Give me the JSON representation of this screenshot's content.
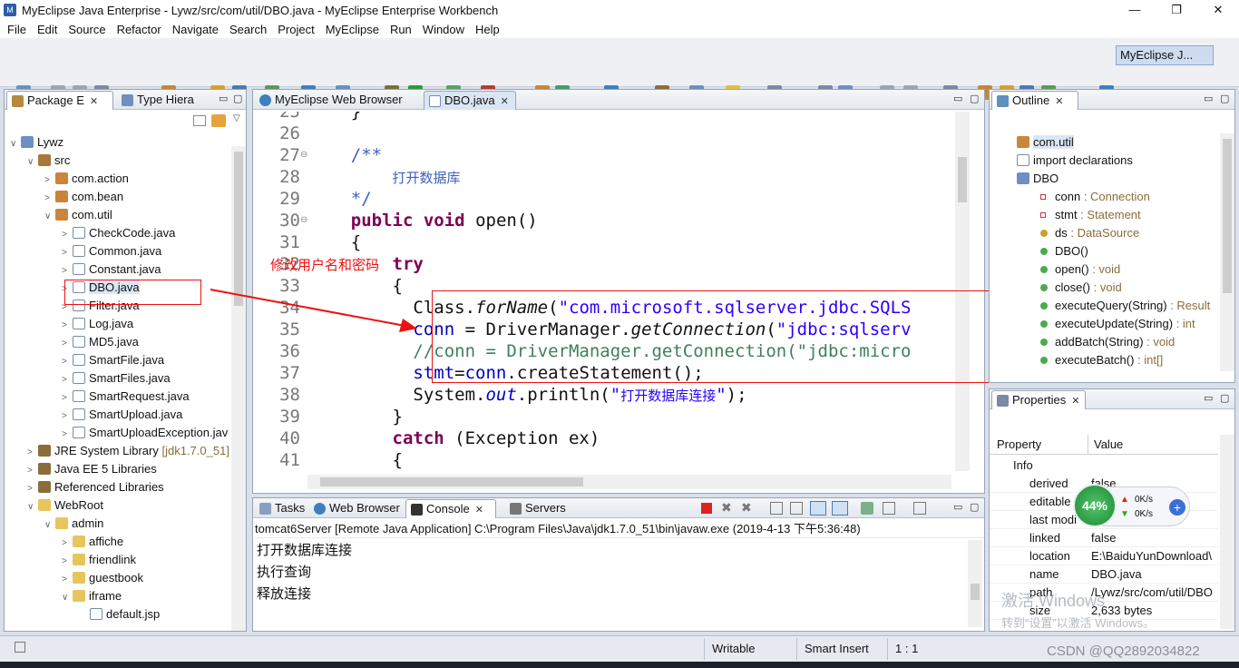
{
  "window": {
    "title": "MyEclipse Java Enterprise - Lywz/src/com/util/DBO.java - MyEclipse Enterprise Workbench",
    "minimize": "—",
    "maximize": "❐",
    "close": "✕"
  },
  "menu": [
    "File",
    "Edit",
    "Source",
    "Refactor",
    "Navigate",
    "Search",
    "Project",
    "MyEclipse",
    "Run",
    "Window",
    "Help"
  ],
  "perspective": "MyEclipse J...",
  "left_panel": {
    "tabs": [
      "Package E",
      "Type Hiera"
    ],
    "tree": [
      {
        "label": "Lywz",
        "indent": 0,
        "icon": "project-icon",
        "arrow": "∨"
      },
      {
        "label": "src",
        "indent": 1,
        "icon": "source-folder-icon",
        "arrow": "∨"
      },
      {
        "label": "com.action",
        "indent": 2,
        "icon": "package-icon",
        "arrow": ">"
      },
      {
        "label": "com.bean",
        "indent": 2,
        "icon": "package-icon",
        "arrow": ">"
      },
      {
        "label": "com.util",
        "indent": 2,
        "icon": "package-icon",
        "arrow": "∨"
      },
      {
        "label": "CheckCode.java",
        "indent": 3,
        "icon": "java-file-icon",
        "arrow": ">"
      },
      {
        "label": "Common.java",
        "indent": 3,
        "icon": "java-file-icon",
        "arrow": ">"
      },
      {
        "label": "Constant.java",
        "indent": 3,
        "icon": "java-file-icon",
        "arrow": ">"
      },
      {
        "label": "DBO.java",
        "indent": 3,
        "icon": "java-file-icon",
        "arrow": ">"
      },
      {
        "label": "Filter.java",
        "indent": 3,
        "icon": "java-file-icon",
        "arrow": ">"
      },
      {
        "label": "Log.java",
        "indent": 3,
        "icon": "java-file-icon",
        "arrow": ">"
      },
      {
        "label": "MD5.java",
        "indent": 3,
        "icon": "java-file-icon",
        "arrow": ">"
      },
      {
        "label": "SmartFile.java",
        "indent": 3,
        "icon": "java-file-icon",
        "arrow": ">"
      },
      {
        "label": "SmartFiles.java",
        "indent": 3,
        "icon": "java-file-icon",
        "arrow": ">"
      },
      {
        "label": "SmartRequest.java",
        "indent": 3,
        "icon": "java-file-icon",
        "arrow": ">"
      },
      {
        "label": "SmartUpload.java",
        "indent": 3,
        "icon": "java-file-icon",
        "arrow": ">"
      },
      {
        "label": "SmartUploadException.jav",
        "indent": 3,
        "icon": "java-file-icon",
        "arrow": ">"
      },
      {
        "label": "JRE System Library",
        "suffix": "[jdk1.7.0_51]",
        "indent": 1,
        "icon": "library-icon",
        "arrow": ">"
      },
      {
        "label": "Java EE 5 Libraries",
        "indent": 1,
        "icon": "library-icon",
        "arrow": ">"
      },
      {
        "label": "Referenced Libraries",
        "indent": 1,
        "icon": "library-icon",
        "arrow": ">"
      },
      {
        "label": "WebRoot",
        "indent": 1,
        "icon": "folder-icon",
        "arrow": "∨"
      },
      {
        "label": "admin",
        "indent": 2,
        "icon": "folder-icon",
        "arrow": "∨"
      },
      {
        "label": "affiche",
        "indent": 3,
        "icon": "folder-icon",
        "arrow": ">"
      },
      {
        "label": "friendlink",
        "indent": 3,
        "icon": "folder-icon",
        "arrow": ">"
      },
      {
        "label": "guestbook",
        "indent": 3,
        "icon": "folder-icon",
        "arrow": ">"
      },
      {
        "label": "iframe",
        "indent": 3,
        "icon": "folder-icon",
        "arrow": "∨"
      },
      {
        "label": "default.jsp",
        "indent": 4,
        "icon": "jsp-file-icon",
        "arrow": ""
      }
    ]
  },
  "editor": {
    "tabs": [
      "MyEclipse Web Browser",
      "DBO.java"
    ],
    "lines": [
      {
        "n": "25",
        "html": "    }"
      },
      {
        "n": "26",
        "html": ""
      },
      {
        "n": "27",
        "fold": "⊖",
        "html": "    <span class=\"cm\">/**</span>"
      },
      {
        "n": "28",
        "html": "        <span class=\"cm\" style=\"font-family:'DejaVu Sans',sans-serif;font-size:15px\">打开数据库</span>"
      },
      {
        "n": "29",
        "html": "    <span class=\"cm\">*/</span>"
      },
      {
        "n": "30",
        "fold": "⊖",
        "html": "    <span class=\"kw\">public</span> <span class=\"kw\">void</span> open()"
      },
      {
        "n": "31",
        "html": "    {"
      },
      {
        "n": "32",
        "html": "        <span class=\"kw\">try</span>"
      },
      {
        "n": "33",
        "html": "        {"
      },
      {
        "n": "34",
        "html": "          Class.<span class=\"it\">forName</span>(<span class=\"st\">\"com.microsoft.sqlserver.jdbc.SQLS</span>"
      },
      {
        "n": "35",
        "html": "          <span style=\"color:#0000c0\">conn</span> = DriverManager.<span class=\"it\">getConnection</span>(<span class=\"st\">\"jdbc:sqlserv</span>"
      },
      {
        "n": "36",
        "html": "          <span class=\"cgreen\">//conn = DriverManager.getConnection(\"jdbc:micro</span>"
      },
      {
        "n": "37",
        "html": "          <span style=\"color:#0000c0\">stmt</span>=<span style=\"color:#0000c0\">conn</span>.createStatement();"
      },
      {
        "n": "38",
        "html": "          System.<span class=\"it\" style=\"color:#0000c0\">out</span>.println(<span class=\"st\">\"<span style=\"font-family:'DejaVu Sans',sans-serif;font-size:15px\">打开数据库连接</span>\"</span>);"
      },
      {
        "n": "39",
        "html": "        }"
      },
      {
        "n": "40",
        "html": "        <span class=\"kw\">catch</span> (Exception ex)"
      },
      {
        "n": "41",
        "html": "        {"
      }
    ]
  },
  "annotation": {
    "text": "修改用户名和密码"
  },
  "outline": {
    "title": "Outline",
    "items": [
      {
        "label": "com.util",
        "type": "",
        "icon": "package-icon",
        "indent": 0
      },
      {
        "label": "import declarations",
        "type": "",
        "icon": "import-icon",
        "indent": 0
      },
      {
        "label": "DBO",
        "type": "",
        "icon": "class-icon",
        "indent": 0
      },
      {
        "label": "conn",
        "type": " : Connection",
        "icon": "private-field-icon",
        "indent": 1
      },
      {
        "label": "stmt",
        "type": " : Statement",
        "icon": "private-field-icon",
        "indent": 1
      },
      {
        "label": "ds",
        "type": " : DataSource",
        "icon": "static-field-icon",
        "indent": 1
      },
      {
        "label": "DBO()",
        "type": "",
        "icon": "constructor-icon",
        "indent": 1
      },
      {
        "label": "open()",
        "type": " : void",
        "icon": "public-method-icon",
        "indent": 1
      },
      {
        "label": "close()",
        "type": " : void",
        "icon": "public-method-icon",
        "indent": 1
      },
      {
        "label": "executeQuery(String)",
        "type": " : Result",
        "icon": "public-method-icon",
        "indent": 1
      },
      {
        "label": "executeUpdate(String)",
        "type": " : int",
        "icon": "public-method-icon",
        "indent": 1
      },
      {
        "label": "addBatch(String)",
        "type": " : void",
        "icon": "public-method-icon",
        "indent": 1
      },
      {
        "label": "executeBatch()",
        "type": " : int[]",
        "icon": "public-method-icon",
        "indent": 1
      }
    ]
  },
  "properties": {
    "title": "Properties",
    "col_property": "Property",
    "col_value": "Value",
    "group": "Info",
    "rows": [
      {
        "k": "derived",
        "v": "false"
      },
      {
        "k": "editable",
        "v": "true"
      },
      {
        "k": "last modi",
        "v": "年12:2.."
      },
      {
        "k": "linked",
        "v": "false"
      },
      {
        "k": "location",
        "v": "E:\\BaiduYunDownload\\"
      },
      {
        "k": "name",
        "v": "DBO.java"
      },
      {
        "k": "path",
        "v": "/Lywz/src/com/util/DBO"
      },
      {
        "k": "size",
        "v": "2,633  bytes"
      }
    ]
  },
  "console": {
    "tabs": [
      "Tasks",
      "Web Browser",
      "Console",
      "Servers"
    ],
    "header": "tomcat6Server [Remote Java Application] C:\\Program Files\\Java\\jdk1.7.0_51\\bin\\javaw.exe (2019-4-13 下午5:36:48)",
    "output": [
      "打开数据库连接",
      "执行查询",
      "释放连接"
    ]
  },
  "net_widget": {
    "percent": "44%",
    "up": "0K/s",
    "down": "0K/s",
    "level": 0.44
  },
  "watermark": {
    "line1": "激活 Windows",
    "line2": "转到“设置”以激活 Windows。"
  },
  "status": {
    "writable": "Writable",
    "insert": "Smart Insert",
    "pos": "1 : 1",
    "credit": "CSDN @QQ2892034822"
  },
  "colors": {
    "keyword": "#7f0055",
    "comment": "#3f5fbf",
    "string": "#2a00ff",
    "annotation": "#ee1111"
  }
}
